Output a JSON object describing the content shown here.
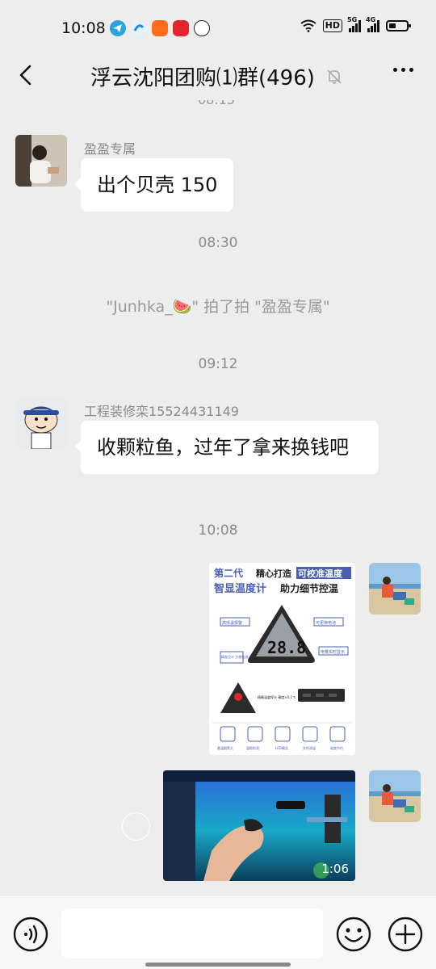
{
  "status_bar": {
    "time": "10:08",
    "hd": "HD",
    "sig1": "5G",
    "sig2": "4G"
  },
  "header": {
    "title": "浮云沈阳团购⑴群(496)"
  },
  "messages": {
    "m1": {
      "sender": "盈盈专属",
      "text": "出个贝壳 150"
    },
    "t1": "08:30",
    "system": "\"Junhka_🍉\" 拍了拍 \"盈盈专属\"",
    "t2": "09:12",
    "m2": {
      "sender": "工程装修栾15524431149",
      "text": "收颗粒鱼，过年了拿来换钱吧"
    },
    "t3": "10:08",
    "video_duration": "1:06"
  },
  "product_image": {
    "line1_a": "第二代",
    "line1_b": "精心打造",
    "line1_c": "可校准温度",
    "line2_a": "智显温度计",
    "line2_b": "助力细节控温",
    "reading": "28.8",
    "features": [
      "高低温报警",
      "可更换电池",
      "精准设计 方便检测",
      "电量实时显示",
      "精确温度探头 精度±0.1℃"
    ],
    "bottom_icons": [
      "悬温报警大",
      "温稳检测",
      "LED模显",
      "实时测温",
      "极度节约"
    ]
  },
  "colors": {
    "bubble": "#ffffff",
    "background": "#ededed",
    "accent": "#4a5fb4"
  }
}
